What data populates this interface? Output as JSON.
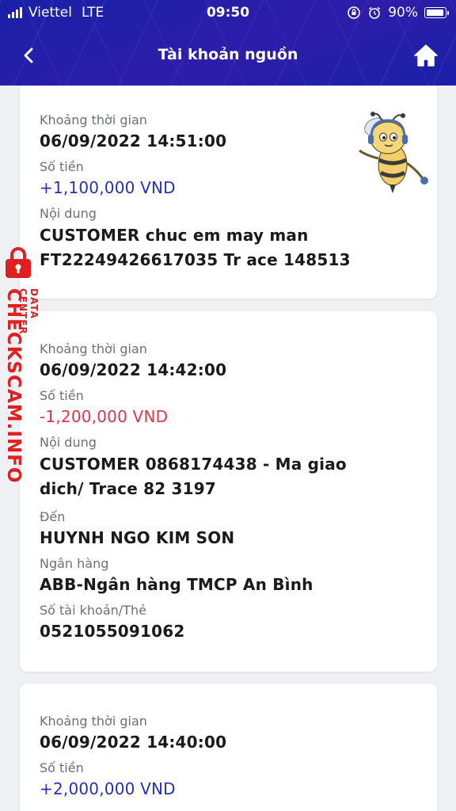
{
  "status_bar": {
    "carrier": "Viettel",
    "network": "LTE",
    "time": "09:50",
    "battery": "90%"
  },
  "nav": {
    "title": "Tài khoản nguồn",
    "back_icon": "chevron-left-icon",
    "home_icon": "home-icon"
  },
  "colors": {
    "header_bg": "#1a1fa8",
    "credit": "#2630b8",
    "debit": "#e0344b",
    "watermark": "#e02020"
  },
  "transactions": [
    {
      "time_label": "Khoảng thời gian",
      "time": "06/09/2022 14:51:00",
      "amount_label": "Số tiền",
      "amount": "+1,100,000 VND",
      "content_label": "Nội dung",
      "content_line1": "CUSTOMER chuc em may man",
      "content_line2": "FT22249426617035 Tr ace 148513"
    },
    {
      "time_label": "Khoảng thời gian",
      "time": "06/09/2022 14:42:00",
      "amount_label": "Số tiền",
      "amount": "-1,200,000 VND",
      "content_label": "Nội dung",
      "content_line1": "CUSTOMER 0868174438 - Ma giao",
      "content_line2": "dich/ Trace 82 3197",
      "to_label": "Đến",
      "to": "HUYNH NGO KIM SON",
      "bank_label": "Ngân hàng",
      "bank": "ABB-Ngân hàng TMCP An Bình",
      "account_label": "Số tài khoản/Thẻ",
      "account": "0521055091062"
    },
    {
      "time_label": "Khoảng thời gian",
      "time": "06/09/2022 14:40:00",
      "amount_label": "Số tiền",
      "amount": "+2,000,000 VND"
    }
  ],
  "watermark": {
    "main": "CHECKSCAM.INFO",
    "sub": "DATA CENTER",
    "icon": "lock-icon"
  }
}
